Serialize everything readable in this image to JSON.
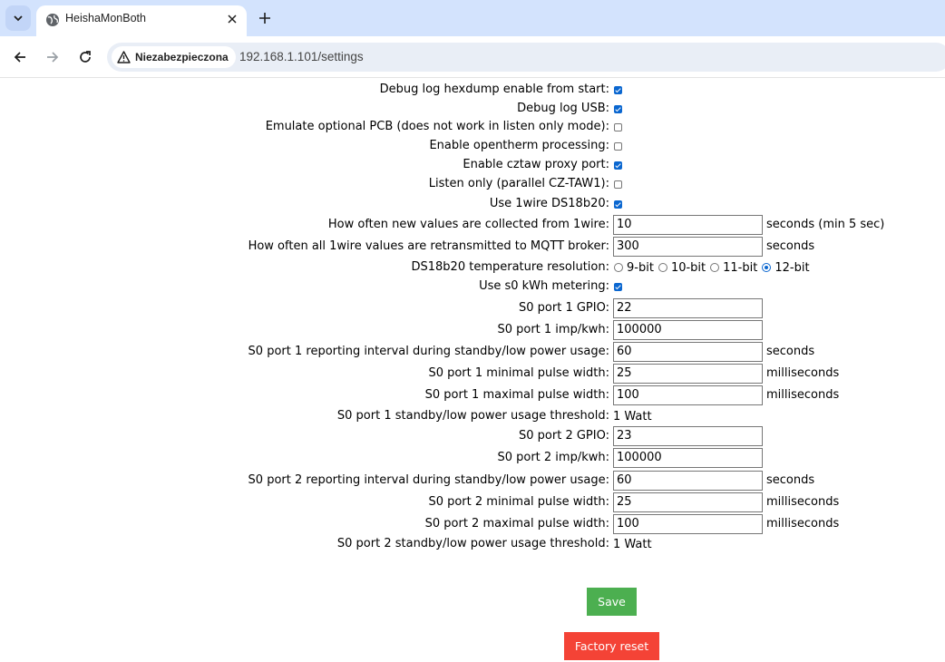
{
  "browser": {
    "tab_title": "HeishaMonBoth",
    "security_label": "Niezabezpieczona",
    "url": "192.168.1.101/settings"
  },
  "settings": {
    "debug_hexdump": {
      "label": "Debug log hexdump enable from start:",
      "checked": true
    },
    "debug_usb": {
      "label": "Debug log USB:",
      "checked": true
    },
    "emulate_pcb": {
      "label": "Emulate optional PCB (does not work in listen only mode):",
      "checked": false
    },
    "opentherm": {
      "label": "Enable opentherm processing:",
      "checked": false
    },
    "cztaw_proxy": {
      "label": "Enable cztaw proxy port:",
      "checked": true
    },
    "listen_only": {
      "label": "Listen only (parallel CZ-TAW1):",
      "checked": false
    },
    "use_1wire": {
      "label": "Use 1wire DS18b20:",
      "checked": true
    },
    "onewire_collect": {
      "label": "How often new values are collected from 1wire:",
      "value": "10",
      "unit": "seconds (min 5 sec)"
    },
    "onewire_retransmit": {
      "label": "How often all 1wire values are retransmitted to MQTT broker:",
      "value": "300",
      "unit": "seconds"
    },
    "ds18b20_resolution": {
      "label": "DS18b20 temperature resolution:",
      "options": [
        "9-bit",
        "10-bit",
        "11-bit",
        "12-bit"
      ],
      "selected": "12-bit"
    },
    "use_s0": {
      "label": "Use s0 kWh metering:",
      "checked": true
    },
    "s0_1_gpio": {
      "label": "S0 port 1 GPIO:",
      "value": "22"
    },
    "s0_1_imp": {
      "label": "S0 port 1 imp/kwh:",
      "value": "100000"
    },
    "s0_1_interval": {
      "label": "S0 port 1 reporting interval during standby/low power usage:",
      "value": "60",
      "unit": "seconds"
    },
    "s0_1_minpulse": {
      "label": "S0 port 1 minimal pulse width:",
      "value": "25",
      "unit": "milliseconds"
    },
    "s0_1_maxpulse": {
      "label": "S0 port 1 maximal pulse width:",
      "value": "100",
      "unit": "milliseconds"
    },
    "s0_1_threshold": {
      "label": "S0 port 1 standby/low power usage threshold:",
      "value": "1 Watt"
    },
    "s0_2_gpio": {
      "label": "S0 port 2 GPIO:",
      "value": "23"
    },
    "s0_2_imp": {
      "label": "S0 port 2 imp/kwh:",
      "value": "100000"
    },
    "s0_2_interval": {
      "label": "S0 port 2 reporting interval during standby/low power usage:",
      "value": "60",
      "unit": "seconds"
    },
    "s0_2_minpulse": {
      "label": "S0 port 2 minimal pulse width:",
      "value": "25",
      "unit": "milliseconds"
    },
    "s0_2_maxpulse": {
      "label": "S0 port 2 maximal pulse width:",
      "value": "100",
      "unit": "milliseconds"
    },
    "s0_2_threshold": {
      "label": "S0 port 2 standby/low power usage threshold:",
      "value": "1 Watt"
    }
  },
  "buttons": {
    "save": "Save",
    "factory_reset": "Factory reset"
  },
  "colors": {
    "save_bg": "#4caf50",
    "reset_bg": "#f44336",
    "check_accent": "#0b67d0"
  }
}
